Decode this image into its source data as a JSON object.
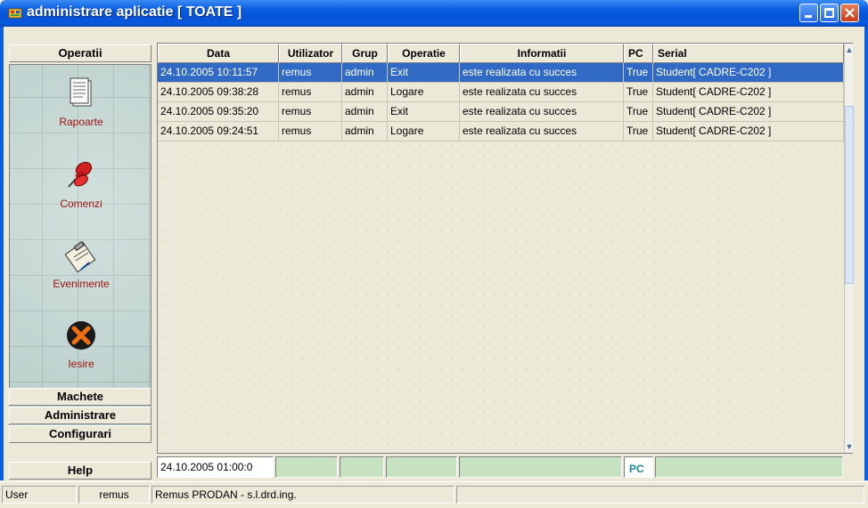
{
  "window": {
    "title": "administrare aplicatie [ TOATE ]"
  },
  "sidebar": {
    "top_button": "Operatii",
    "items": [
      {
        "label": "Rapoarte",
        "icon": "report-icon"
      },
      {
        "label": "Comenzi",
        "icon": "pushpin-icon"
      },
      {
        "label": "Evenimente",
        "icon": "clipboard-icon"
      },
      {
        "label": "Iesire",
        "icon": "exit-icon"
      }
    ],
    "bottom_buttons": [
      "Machete",
      "Administrare",
      "Configurari",
      "Help"
    ]
  },
  "table": {
    "columns": [
      "Data",
      "Utilizator",
      "Grup",
      "Operatie",
      "Informatii",
      "PC",
      "Serial"
    ],
    "rows": [
      [
        "24.10.2005 10:11:57",
        "remus",
        "admin",
        "Exit",
        "este realizata cu succes",
        "True",
        "Student[ CADRE-C202 ]"
      ],
      [
        "24.10.2005 09:38:28",
        "remus",
        "admin",
        "Logare",
        "este realizata cu succes",
        "True",
        "Student[ CADRE-C202 ]"
      ],
      [
        "24.10.2005 09:35:20",
        "remus",
        "admin",
        "Exit",
        "este realizata cu succes",
        "True",
        "Student[ CADRE-C202 ]"
      ],
      [
        "24.10.2005 09:24:51",
        "remus",
        "admin",
        "Logare",
        "este realizata cu succes",
        "True",
        "Student[ CADRE-C202 ]"
      ]
    ],
    "selected_row": 0
  },
  "filter": {
    "date_value": "24.10.2005 01:00:0",
    "pc_label": "PC"
  },
  "status": {
    "label": "User",
    "user": "remus",
    "info": "Remus PRODAN - s.l.drd.ing."
  },
  "colors": {
    "title_bar": "#0a5ee0",
    "selection": "#316ac5",
    "sidebar_label": "#9b1010",
    "filter_cell": "#c6e2c0"
  }
}
